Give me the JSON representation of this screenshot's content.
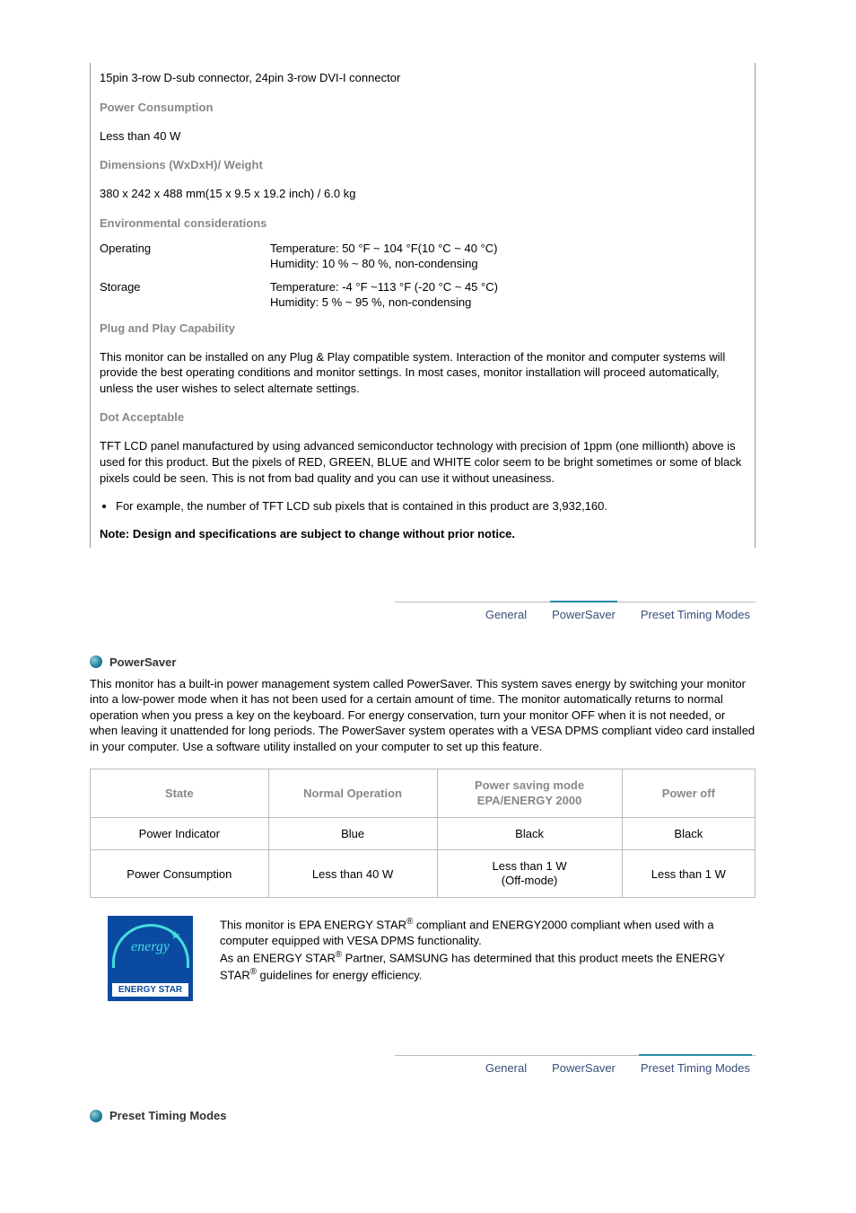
{
  "spec": {
    "connector": "15pin 3-row D-sub connector, 24pin 3-row DVI-I connector",
    "power_consumption_label": "Power Consumption",
    "power_consumption_value": "Less than 40 W",
    "dimensions_label": "Dimensions (WxDxH)/ Weight",
    "dimensions_value": "380 x 242 x 488 mm(15 x 9.5 x 19.2 inch) / 6.0 kg",
    "env_label": "Environmental considerations",
    "env_operating_key": "Operating",
    "env_operating_val": "Temperature: 50 °F ~ 104 °F(10 °C ~ 40 °C)\nHumidity: 10 % ~ 80 %, non-condensing",
    "env_storage_key": "Storage",
    "env_storage_val": "Temperature: -4 °F ~113 °F (-20 °C ~ 45 °C)\nHumidity: 5 % ~ 95 %, non-condensing",
    "pnp_label": "Plug and Play Capability",
    "pnp_body": "This monitor can be installed on any Plug & Play compatible system. Interaction of the monitor and computer systems will provide the best operating conditions and monitor settings. In most cases, monitor installation will proceed automatically, unless the user wishes to select alternate settings.",
    "dot_label": "Dot Acceptable",
    "dot_body": "TFT LCD panel manufactured by using advanced semiconductor technology with precision of 1ppm (one millionth) above is used for this product. But the pixels of RED, GREEN, BLUE and WHITE color seem to be bright sometimes or some of black pixels could be seen. This is not from bad quality and you can use it without uneasiness.",
    "dot_bullet": "For example, the number of TFT LCD sub pixels that is contained in this product are 3,932,160.",
    "note": "Note: Design and specifications are subject to change without prior notice."
  },
  "tabs": {
    "general": "General",
    "powersaver": "PowerSaver",
    "preset": "Preset Timing Modes"
  },
  "ps": {
    "title": "PowerSaver",
    "body": "This monitor has a built-in power management system called PowerSaver. This system saves energy by switching your monitor into a low-power mode when it has not been used for a certain amount of time. The monitor automatically returns to normal operation when you press a key on the keyboard. For energy conservation, turn your monitor OFF when it is not needed, or when leaving it unattended for long periods. The PowerSaver system operates with a VESA DPMS compliant video card installed in your computer. Use a software utility installed on your computer to set up this feature.",
    "table": {
      "h_state": "State",
      "h_normal": "Normal Operation",
      "h_saving1": "Power saving mode",
      "h_saving2": "EPA/ENERGY 2000",
      "h_off": "Power off",
      "r1_label": "Power Indicator",
      "r1_normal": "Blue",
      "r1_saving": "Black",
      "r1_off": "Black",
      "r2_label": "Power Consumption",
      "r2_normal": "Less than 40 W",
      "r2_saving1": "Less than 1 W",
      "r2_saving2": "(Off-mode)",
      "r2_off": "Less than 1 W"
    }
  },
  "energy": {
    "logo_script": "energy",
    "logo_label": "ENERGY STAR",
    "text1a": "This monitor is EPA ENERGY STAR",
    "text1b": " compliant and ENERGY2000 compliant when used with a computer equipped with VESA DPMS functionality.",
    "text2a": "As an ENERGY STAR",
    "text2b": " Partner, SAMSUNG has determined that this product meets the ENERGY STAR",
    "text2c": " guidelines for energy efficiency."
  },
  "preset": {
    "title": "Preset Timing Modes"
  }
}
